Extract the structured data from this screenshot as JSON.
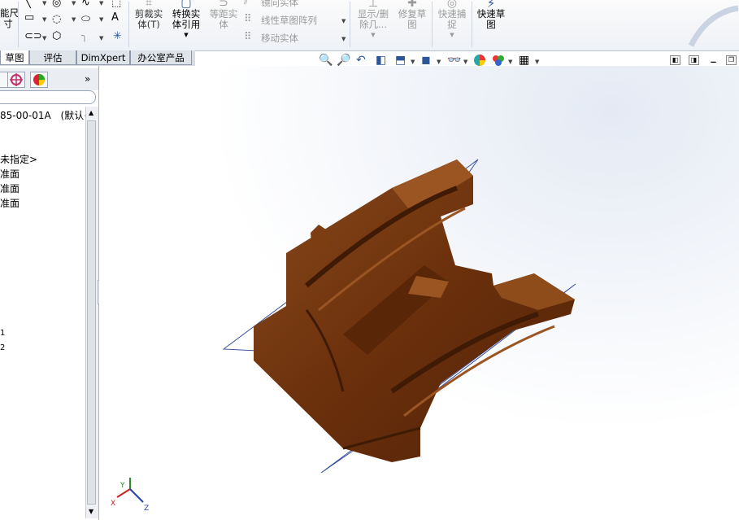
{
  "ribbon": {
    "items": [
      {
        "id": "smart-dim",
        "label": "能尺\n寸"
      },
      {
        "id": "trim",
        "label": "剪裁实\n体(T)"
      },
      {
        "id": "convert",
        "label": "转换实\n体引用"
      },
      {
        "id": "offset",
        "label": "等距实\n体"
      },
      {
        "id": "mirror",
        "label": "镜向实体"
      },
      {
        "id": "linear-pattern",
        "label": "线性草图阵列"
      },
      {
        "id": "move",
        "label": "移动实体"
      },
      {
        "id": "display-delete",
        "label": "显示/删\n除几..."
      },
      {
        "id": "repair",
        "label": "修复草\n图"
      },
      {
        "id": "quick-snap",
        "label": "快速捕\n捉"
      },
      {
        "id": "rapid-sketch",
        "label": "快速草\n图"
      }
    ]
  },
  "tabs": [
    {
      "label": "草图"
    },
    {
      "label": "评估"
    },
    {
      "label": "DimXpert"
    },
    {
      "label": "办公室产品"
    }
  ],
  "tree": {
    "part_name": "85-00-01A",
    "config": "(默认<",
    "material": "未指定>",
    "planes": [
      "准面",
      "准面",
      "准面"
    ],
    "items": [
      "1",
      "2"
    ]
  },
  "axes": {
    "x": "X",
    "y": "Y",
    "z": "Z"
  },
  "colors": {
    "model": "#6b300c",
    "plane": "#3a4f9a",
    "accent": "#2b579a"
  }
}
